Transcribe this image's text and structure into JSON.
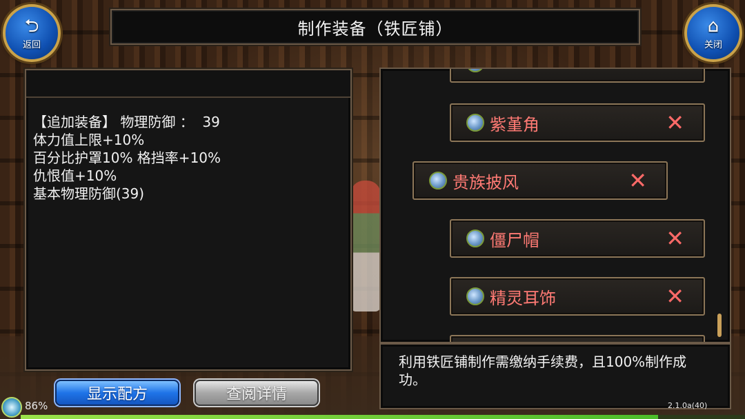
{
  "title": "制作装备（铁匠铺）",
  "nav": {
    "back_label": "返回",
    "back_icon": "return-arrow-icon",
    "close_label": "关闭",
    "close_icon": "home-icon"
  },
  "description": {
    "lines": [
      "【追加装备】 物理防御 ：  39",
      "体力值上限+10%",
      "百分比护罩10% 格挡率+10%",
      "仇恨值+10%",
      "基本物理防御(39)"
    ]
  },
  "recipe_list": {
    "items": [
      {
        "name": "紫堇角",
        "icon": "item-icon",
        "remove_symbol": "✕"
      },
      {
        "name": "贵族披风",
        "icon": "item-icon",
        "remove_symbol": "✕"
      },
      {
        "name": "僵尸帽",
        "icon": "item-icon",
        "remove_symbol": "✕"
      },
      {
        "name": "精灵耳饰",
        "icon": "item-icon",
        "remove_symbol": "✕"
      }
    ],
    "remove_color": "#ff6a68",
    "name_color": "#ff7a74"
  },
  "info_text": "利用铁匠铺制作需缴纳手续费，且100%制作成功。",
  "buttons": {
    "show_recipe": "显示配方",
    "view_details": "查阅详情"
  },
  "status": {
    "battery": "86%",
    "version": "2.1.0a(40)",
    "exp_progress": 0.88
  }
}
